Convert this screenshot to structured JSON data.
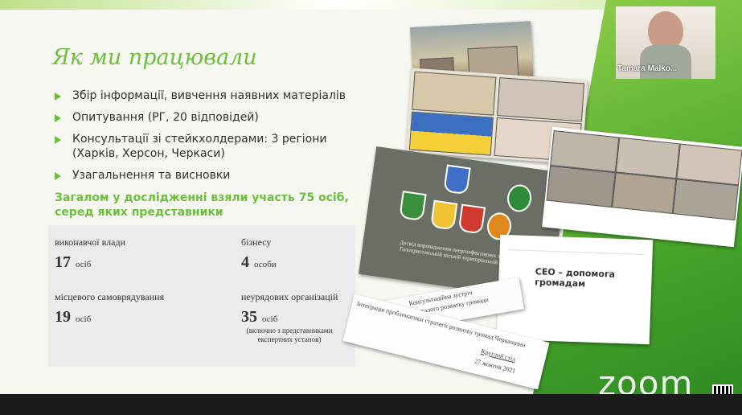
{
  "slide": {
    "title": "Як ми працювали",
    "bullets": [
      "Збір інформації, вивчення наявних матеріалів",
      "Опитування (РГ, 20 відповідей)",
      "Консультації зі стейкхолдерами: 3 регіони (Харків, Херсон, Черкаси)",
      "Узагальнення та висновки"
    ],
    "summary": "Загалом у дослідженні взяли участь 75 осіб, серед яких представники",
    "stats": [
      {
        "label": "виконавчої влади",
        "value": "17",
        "unit": "осіб"
      },
      {
        "label": "бізнесу",
        "value": "4",
        "unit": "особи"
      },
      {
        "label": "місцевого самоврядування",
        "value": "19",
        "unit": "осіб"
      },
      {
        "label": "неурядових організацій",
        "value": "35",
        "unit": "осіб",
        "note": "(включно з представниками експертних установ)"
      }
    ]
  },
  "collage": {
    "doc_title": "CEO – допомога громадам",
    "emblem_caption": "Досвід впровадження енергоефективних заходів у Голопристанській міській територіальній громаді",
    "note_1": "Консультаційна зустріч",
    "note_1b": "з екологічно сталого розвитку громади",
    "note_2": "Інтеграція проблематики стратегії розвитку громад Черкащини",
    "note_2b": "Круглий стіл",
    "note_2c": "27 жовтня 2021"
  },
  "participant": {
    "name": "Tamara Malko..."
  },
  "branding": {
    "watermark": "zoom"
  },
  "colors": {
    "accent": "#6cbf3c",
    "wedge": "#4aa62c"
  }
}
